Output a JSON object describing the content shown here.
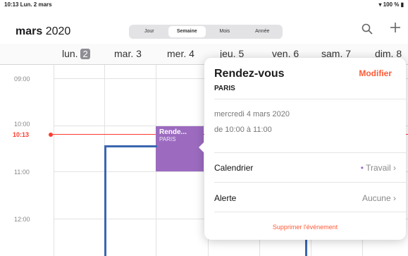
{
  "status": {
    "time": "10:13  Lun. 2 mars",
    "battery": "100 %"
  },
  "header": {
    "month": "mars",
    "year": "2020",
    "segments": [
      "Jour",
      "Semaine",
      "Mois",
      "Année"
    ],
    "active_segment": "Semaine",
    "search_icon": "search-icon",
    "add_icon": "plus-icon"
  },
  "days": [
    {
      "name": "lun.",
      "num": "2",
      "today": true
    },
    {
      "name": "mar.",
      "num": "3"
    },
    {
      "name": "mer.",
      "num": "4"
    },
    {
      "name": "jeu.",
      "num": "5"
    },
    {
      "name": "ven.",
      "num": "6"
    },
    {
      "name": "sam.",
      "num": "7"
    },
    {
      "name": "dim.",
      "num": "8"
    }
  ],
  "hours": [
    "09:00",
    "10:00",
    "11:00",
    "12:00"
  ],
  "now_label": "10:13",
  "event": {
    "title": "Rende...",
    "location": "PARIS",
    "color": "#9c6bc0"
  },
  "popover": {
    "title": "Rendez-vous",
    "edit": "Modifier",
    "location": "PARIS",
    "date": "mercredi 4 mars 2020",
    "time": "de 10:00 à 11:00",
    "calendar_label": "Calendrier",
    "calendar_value": "Travail",
    "alert_label": "Alerte",
    "alert_value": "Aucune",
    "delete": "Supprimer l'événement"
  },
  "colors": {
    "accent": "#ff5a36",
    "now": "#ff3b30",
    "event": "#9c6bc0",
    "callout": "#3a67b0"
  }
}
